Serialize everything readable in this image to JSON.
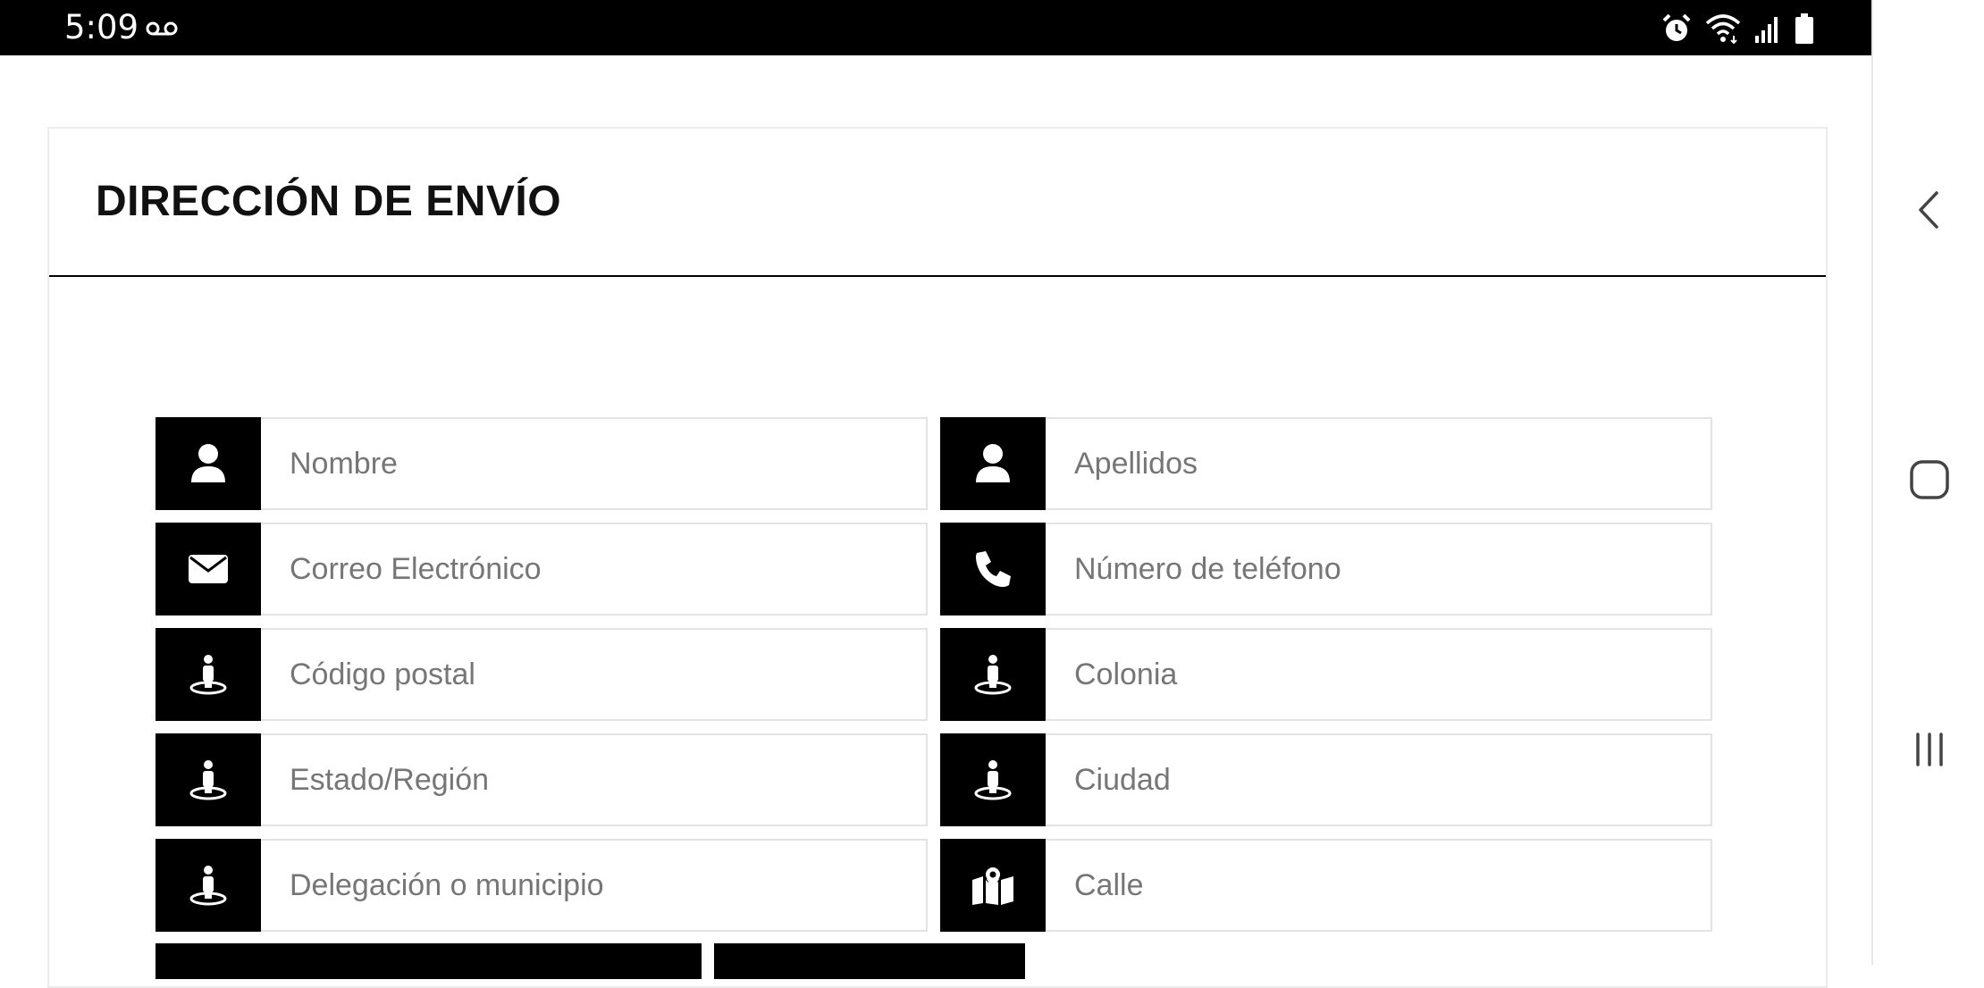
{
  "status_bar": {
    "time": "5:09",
    "icons": [
      "voicemail-icon",
      "alarm-icon",
      "wifi-icon",
      "signal-icon",
      "battery-icon"
    ]
  },
  "card": {
    "title": "DIRECCIÓN DE ENVÍO"
  },
  "form": {
    "first_name": {
      "placeholder": "Nombre",
      "icon": "user-icon"
    },
    "last_name": {
      "placeholder": "Apellidos",
      "icon": "user-icon"
    },
    "email": {
      "placeholder": "Correo Electrónico",
      "icon": "envelope-icon"
    },
    "phone": {
      "placeholder": "Número de teléfono",
      "icon": "phone-icon"
    },
    "postal_code": {
      "placeholder": "Código postal",
      "icon": "street-view-icon"
    },
    "colony": {
      "placeholder": "Colonia",
      "icon": "street-view-icon"
    },
    "state": {
      "placeholder": "Estado/Región",
      "icon": "street-view-icon"
    },
    "city": {
      "placeholder": "Ciudad",
      "icon": "street-view-icon"
    },
    "municipality": {
      "placeholder": "Delegación o municipio",
      "icon": "street-view-icon"
    },
    "street": {
      "placeholder": "Calle",
      "icon": "map-marked-icon"
    }
  },
  "nav_bar": {
    "icons": [
      "back-icon",
      "home-icon",
      "recents-icon"
    ]
  },
  "colors": {
    "icon_bg": "#000000",
    "border": "#e3e3e3",
    "placeholder": "#767676"
  }
}
